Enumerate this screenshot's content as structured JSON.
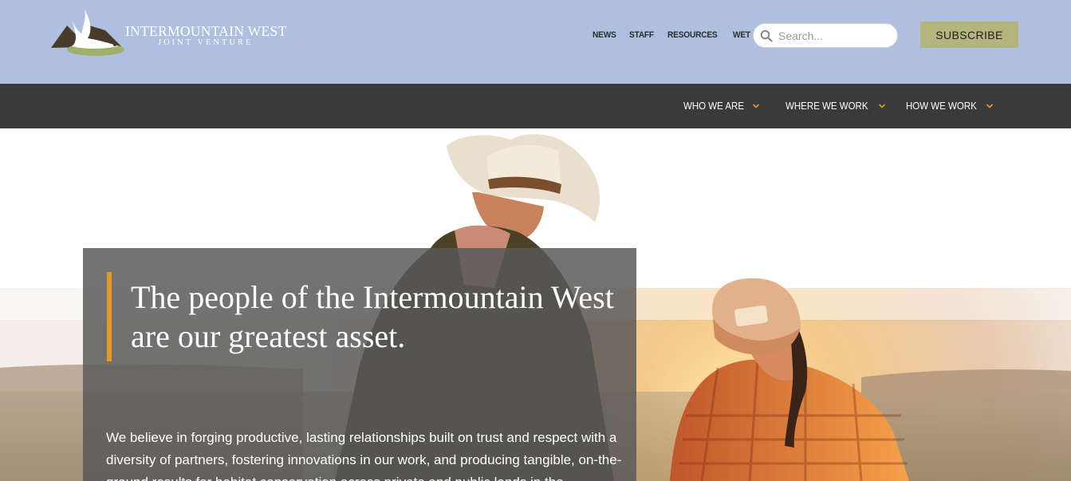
{
  "header": {
    "logo": {
      "title": "INTERMOUNTAIN WEST",
      "subtitle": "JOINT VENTURE"
    },
    "utility_nav": [
      "NEWS",
      "STAFF",
      "RESOURCES",
      "WET"
    ],
    "search": {
      "placeholder": "Search..."
    },
    "subscribe_label": "SUBSCRIBE"
  },
  "main_nav": {
    "items": [
      {
        "label": "WHO WE ARE",
        "icon": "chevron-down-icon"
      },
      {
        "label": "WHERE WE WORK",
        "icon": "chevron-down-icon"
      },
      {
        "label": "HOW WE WORK",
        "icon": "chevron-down-icon"
      }
    ]
  },
  "hero": {
    "heading": "The people of the Intermountain West are our greatest asset.",
    "body": "We believe in forging productive, lasting relationships built on trust and respect with a diversity of partners, fostering innovations in our work, and producing tangible, on-the-ground results for habitat conservation across private and public lands in the",
    "image_description": "two ranchers in hats at sunset"
  },
  "colors": {
    "header_bg": "#aebfdf",
    "nav_bg": "#3a3a3a",
    "accent": "#e59a27",
    "subscribe_bg": "#b3b57c"
  }
}
